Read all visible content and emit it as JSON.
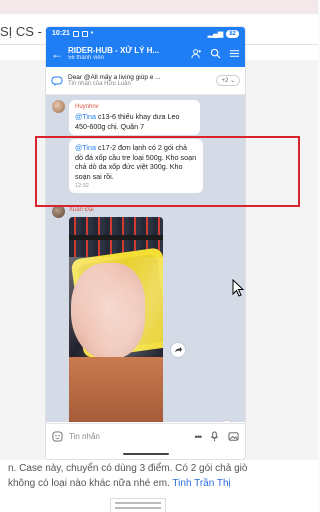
{
  "background": {
    "title": "SỊ CS -",
    "line1_prefix": "n. Case này, chuyển có dùng 3 điểm. Có 2 gói chả giò",
    "line2_prefix": "không có loại nào khác nữa nhé em.",
    "line2_link": "Tinh Trần Thị",
    "colors": {
      "accent": "#2b6de0"
    }
  },
  "status_bar": {
    "time": "10:21",
    "battery": "82"
  },
  "header": {
    "title": "RIDER-HUB - XỬ LÝ H...",
    "subtitle": "56 thành viên",
    "icons": [
      "back-arrow-icon",
      "add-member-icon",
      "search-icon",
      "menu-icon"
    ]
  },
  "pinned": {
    "text": "Dear @All mấy a living giúp e ...",
    "from": "Tin nhắn của Hữu Luân",
    "more": "+2 ⌄"
  },
  "messages": [
    {
      "sender": "Huynhnv",
      "mention": "@Tina",
      "text": " c13-6 thiếu khay dưa Leo 450-600g chị. Quận 7"
    },
    {
      "mention": "@Tina",
      "text": " c17-2 đơn lạnh có 2 gói chả dò đá xốp cầu tre loại 500g. Kho soạn chả dò da xốp đức việt 300g. Kho soạn sai rồi.",
      "time": "12:32"
    },
    {
      "sender": "Xuân Đại",
      "image": "photo of packaged meat on yellow tray"
    }
  ],
  "input": {
    "placeholder": "Tin nhắn"
  },
  "colors": {
    "brand": "#1f7ef4",
    "highlight_border": "#d9232d",
    "sender": "#e0553f"
  }
}
